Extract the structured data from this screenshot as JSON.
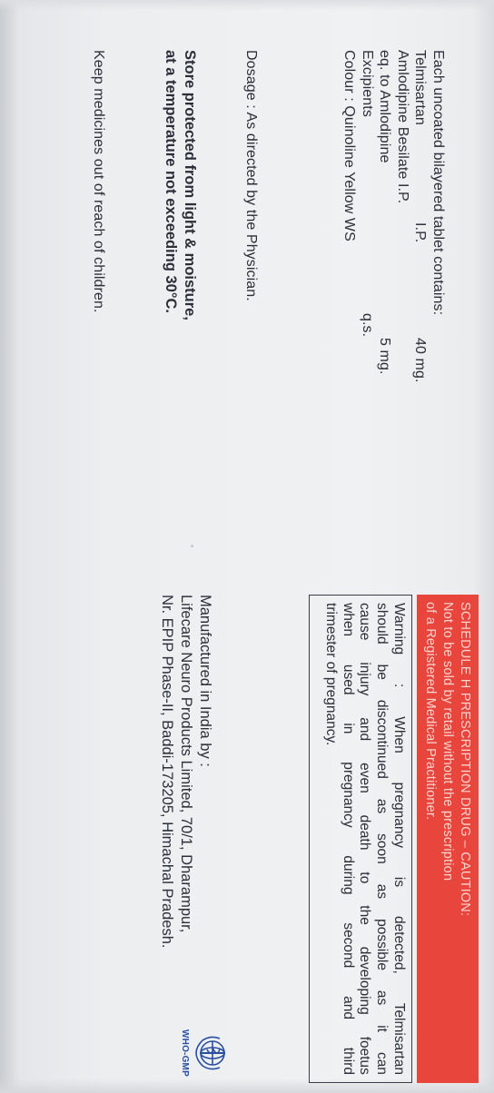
{
  "composition": {
    "lines": [
      "Each uncoated bilayered tablet contains:",
      "Telmisartan",
      "Amlodipine Besilate I.P.",
      "eq. to Amlodipine",
      "Excipients",
      "Colour : Quinoline Yellow  WS"
    ],
    "values": {
      "telmisartan_std": "I.P.",
      "telmisartan_qty": "40 mg.",
      "amlodipine_qty": "5 mg.",
      "excipients_qty": "q.s."
    }
  },
  "dosage": "Dosage : As directed by the Physician.",
  "storage": {
    "line1": "Store protected from light & moisture,",
    "line2": "at a temperature not exceeding 30°C."
  },
  "children_warning": "Keep medicines out of reach of children.",
  "schedule_box": {
    "color": "#e8463d",
    "line1": "SCHEDULE H PRESCRIPTION DRUG – CAUTION:",
    "line2": "Not to be sold by retail without the prescription",
    "line3": "of a Registered Medical Practitioner."
  },
  "warning_box": {
    "lines": [
      [
        "Warning",
        ":",
        "When",
        "pregnancy",
        "is",
        "detected,",
        "Telmisartan"
      ],
      [
        "should",
        "be",
        "discontinued",
        "as",
        "soon",
        "as",
        "possible",
        "as",
        "it",
        "can"
      ],
      [
        "cause",
        "injury",
        "and",
        "even",
        "death",
        "to",
        "the",
        "developing",
        "foetus"
      ],
      [
        "when",
        "used",
        "in",
        "pregnancy",
        "during",
        "second",
        "and",
        "third"
      ]
    ],
    "last_line": "trimester of pregnancy."
  },
  "manufacturer": {
    "line1": "Manufactured in India by :",
    "line2": "Lifecare Neuro Products Limited, 70/1, Dharampur,",
    "line3": "Nr. EPIP Phase-II, Baddi-173205, Himachal Pradesh."
  },
  "logo": {
    "icon": "who-emblem-icon",
    "label": "WHO-GMP",
    "color": "#2b4fa0"
  }
}
